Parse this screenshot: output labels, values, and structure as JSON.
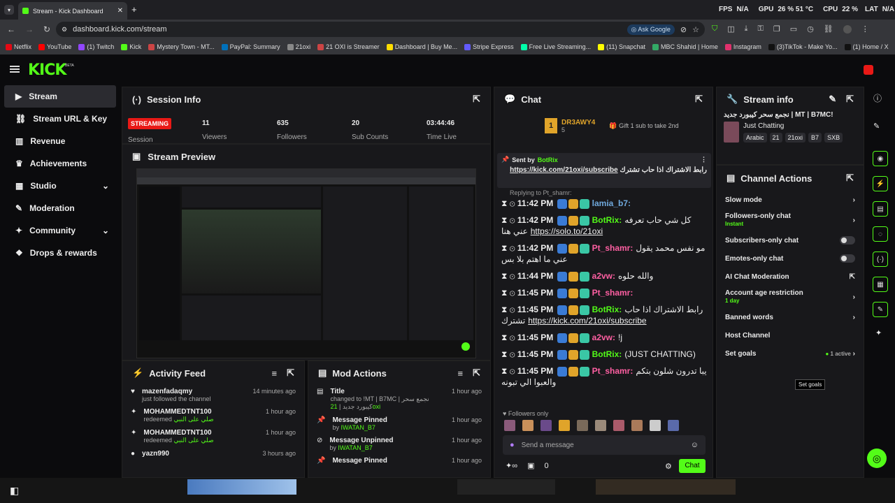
{
  "browser": {
    "tab_title": "Stream - Kick Dashboard",
    "url": "dashboard.kick.com/stream",
    "ask_google": "Ask Google",
    "bookmarks": [
      "Netflix",
      "YouTube",
      "(1) Twitch",
      "Kick",
      "Mystery Town - MT...",
      "PayPal: Summary",
      "21oxi",
      "21 OXI is Streamer",
      "Dashboard | Buy Me...",
      "Stripe Express",
      "Free Live Streaming...",
      "(11) Snapchat",
      "MBC Shahid | Home",
      "Instagram",
      "(3)TikTok - Make Yo...",
      "(1) Home / X"
    ],
    "fps_label": "FPS",
    "fps": "N/A",
    "gpu_label": "GPU",
    "gpu": "26 % 51 °C",
    "cpu_label": "CPU",
    "cpu": "22 %",
    "lat_label": "LAT",
    "lat": "N/A"
  },
  "logo": "KICK",
  "logo_beta": "BETA",
  "sidebar": {
    "items": [
      {
        "label": "Stream"
      },
      {
        "label": "Stream URL & Key"
      },
      {
        "label": "Revenue"
      },
      {
        "label": "Achievements"
      },
      {
        "label": "Studio"
      },
      {
        "label": "Moderation"
      },
      {
        "label": "Community"
      },
      {
        "label": "Drops & rewards"
      }
    ]
  },
  "session": {
    "title": "Session Info",
    "status": "STREAMING",
    "status_label": "Session",
    "viewers": "11",
    "viewers_label": "Viewers",
    "followers": "635",
    "followers_label": "Followers",
    "subs": "20",
    "subs_label": "Sub Counts",
    "time": "03:44:46",
    "time_label": "Time Live"
  },
  "preview": {
    "title": "Stream Preview"
  },
  "activity": {
    "title": "Activity Feed",
    "items": [
      {
        "name": "mazenfadaqmy",
        "sub": "just followed the channel",
        "time": "14 minutes ago"
      },
      {
        "name": "MOHAMMEDTNT100",
        "sub": "redeemed",
        "extra": "صلي على النبي",
        "time": "1 hour ago"
      },
      {
        "name": "MOHAMMEDTNT100",
        "sub": "redeemed",
        "extra": "صلي على النبي",
        "time": "1 hour ago"
      },
      {
        "name": "yazn990",
        "sub": "",
        "time": "3 hours ago"
      }
    ]
  },
  "modactions": {
    "title": "Mod Actions",
    "items": [
      {
        "name": "Title",
        "sub": "changed to !MT | B7MC | نجمع سحر كيبورد جديد |",
        "by": "21oxi",
        "time": "1 hour ago"
      },
      {
        "name": "Message Pinned",
        "sub": "by",
        "by": "IWATAN_B7",
        "time": "1 hour ago"
      },
      {
        "name": "Message Unpinned",
        "sub": "by",
        "by": "IWATAN_B7",
        "time": "1 hour ago"
      },
      {
        "name": "Message Pinned",
        "sub": "",
        "by": "",
        "time": "1 hour ago"
      }
    ]
  },
  "chat": {
    "title": "Chat",
    "top_user": "DR3AWY4",
    "top_rank": "1",
    "top_count": "5",
    "gift_text": "Gift 1 sub to take 2nd",
    "pinned_by_label": "Sent by",
    "pinned_by": "BotRix",
    "pinned_text": "رابط الاشتراك اذا حاب تشترك",
    "pinned_link": "https://kick.com/21oxi/subscribe",
    "replying": "Replying to Pt_shamr:",
    "messages": [
      {
        "time": "11:42 PM",
        "user": "lamia_b7:",
        "color": "#6fa8dc",
        "text": ""
      },
      {
        "time": "11:42 PM",
        "user": "BotRix:",
        "color": "#53fc18",
        "text": "كل شي حاب تعرفه عني هنا",
        "link": "https://solo.to/21oxi"
      },
      {
        "time": "11:42 PM",
        "user": "Pt_shamr:",
        "color": "#ff5fa2",
        "text": "مو نفس محمد يقول عني ما اهتم بلا بس"
      },
      {
        "time": "11:44 PM",
        "user": "a2vw:",
        "color": "#ff5fa2",
        "text": "والله حلوه"
      },
      {
        "time": "11:45 PM",
        "user": "Pt_shamr:",
        "color": "#ff5fa2",
        "text": ""
      },
      {
        "time": "11:45 PM",
        "user": "BotRix:",
        "color": "#53fc18",
        "text": "رابط الاشتراك اذا حاب تشترك",
        "link": "https://kick.com/21oxi/subscribe"
      },
      {
        "time": "11:45 PM",
        "user": "a2vw:",
        "color": "#ff5fa2",
        "text": "!j"
      },
      {
        "time": "11:45 PM",
        "user": "BotRix:",
        "color": "#53fc18",
        "text": "(JUST CHATTING)"
      },
      {
        "time": "11:45 PM",
        "user": "Pt_shamr:",
        "color": "#ff5fa2",
        "text": "يبا تدرون شلون بتكم والعبوا الي تبونه"
      }
    ],
    "followers_only": "Followers only",
    "placeholder": "Send a message",
    "count": "0",
    "send": "Chat"
  },
  "streaminfo": {
    "title": "Stream info",
    "stream_title": "!MT | B7MC | نجمع سحر كيبورد جديد",
    "category": "Just Chatting",
    "tags": [
      "Arabic",
      "21",
      "21oxi",
      "B7",
      "SXB"
    ]
  },
  "channel": {
    "title": "Channel Actions",
    "slow": "Slow mode",
    "followers_only": "Followers-only chat",
    "followers_sub": "Instant",
    "subs_only": "Subscribers-only chat",
    "emotes_only": "Emotes-only chat",
    "ai": "AI Chat Moderation",
    "age": "Account age restriction",
    "age_sub": "1 day",
    "banned": "Banned words",
    "host": "Host Channel",
    "goals": "Set goals",
    "goals_active": "1 active",
    "tooltip": "Set goals"
  },
  "colors": {
    "accent": "#53fc18",
    "panel": "#18181b",
    "bg": "#0b0b0d",
    "live": "#e91916"
  }
}
